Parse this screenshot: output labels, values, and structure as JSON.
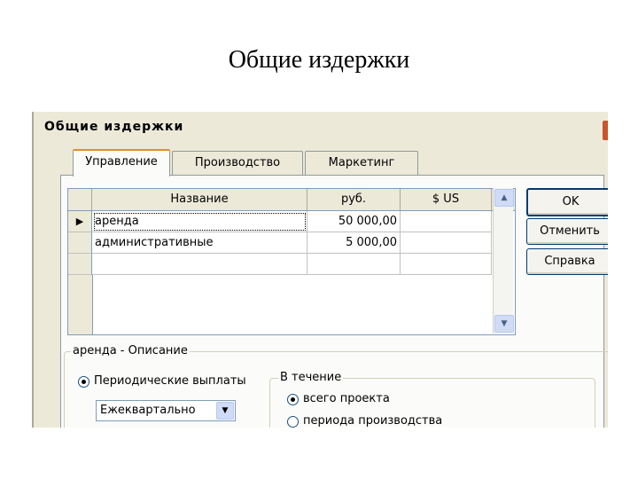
{
  "slide_title": "Общие издержки",
  "window": {
    "title": "Общие издержки"
  },
  "tabs": [
    {
      "label": "Управление",
      "active": true
    },
    {
      "label": "Производство",
      "active": false
    },
    {
      "label": "Маркетинг",
      "active": false
    }
  ],
  "grid": {
    "columns": [
      "Название",
      "руб.",
      "$ US"
    ],
    "rows": [
      {
        "name": "аренда",
        "rub": "50 000,00",
        "usd": "",
        "selected": true
      },
      {
        "name": "административные",
        "rub": "5 000,00",
        "usd": ""
      },
      {
        "name": "",
        "rub": "",
        "usd": ""
      }
    ]
  },
  "buttons": {
    "ok": "OK",
    "cancel": "Отменить",
    "help": "Справка"
  },
  "description": {
    "group_label": "аренда - Описание",
    "periodic_label": "Периодические выплаты",
    "frequency_value": "Ежеквартально"
  },
  "during": {
    "group_label": "В течение",
    "option_whole": "всего проекта",
    "option_production": "периода производства"
  },
  "icons": {
    "row_pointer": "triangle-right-icon",
    "scroll_up": "chevron-up-icon",
    "scroll_down": "chevron-down-icon",
    "dropdown": "chevron-down-icon"
  },
  "colors": {
    "dialog_bg": "#ece9d8",
    "active_tab_accent": "#e68b2c",
    "border": "#7f9db9"
  }
}
